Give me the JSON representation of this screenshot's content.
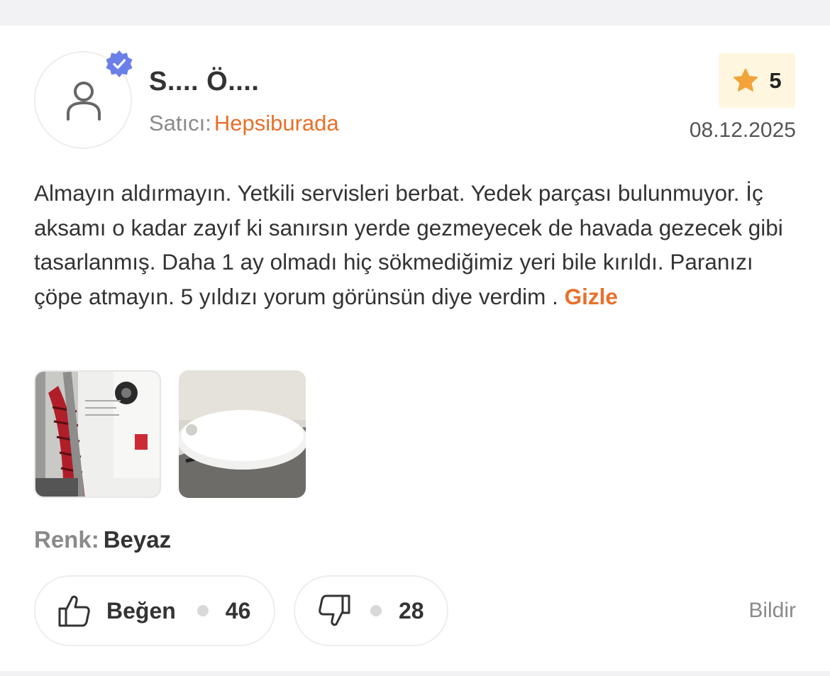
{
  "review": {
    "reviewer_name": "S.... Ö....",
    "seller_label": "Satıcı:",
    "seller_name": "Hepsiburada",
    "rating": "5",
    "date": "08.12.2025",
    "text": "Almayın aldırmayın. Yetkili servisleri berbat. Yedek parçası bulunmuyor. İç aksamı o kadar zayıf ki sanırsın yerde gezmeyecek de havada gezecek gibi tasarlanmış. Daha 1 ay olmadı hiç sökmediğimiz yeri bile kırıldı. Paranızı çöpe atmayın. 5 yıldızı yorum görünsün diye verdim .",
    "hide_label": "Gizle",
    "variant_label": "Renk:",
    "variant_value": "Beyaz"
  },
  "media": [
    {
      "type": "photo",
      "icon": "photo-thumbnail"
    },
    {
      "type": "video",
      "icon": "play-icon"
    }
  ],
  "actions": {
    "like_label": "Beğen",
    "like_count": "46",
    "dislike_count": "28",
    "report_label": "Bildir"
  },
  "colors": {
    "accent": "#e8702a",
    "verified": "#6b7fe8",
    "star": "#f2a33a",
    "rating_bg": "#fff6df"
  }
}
